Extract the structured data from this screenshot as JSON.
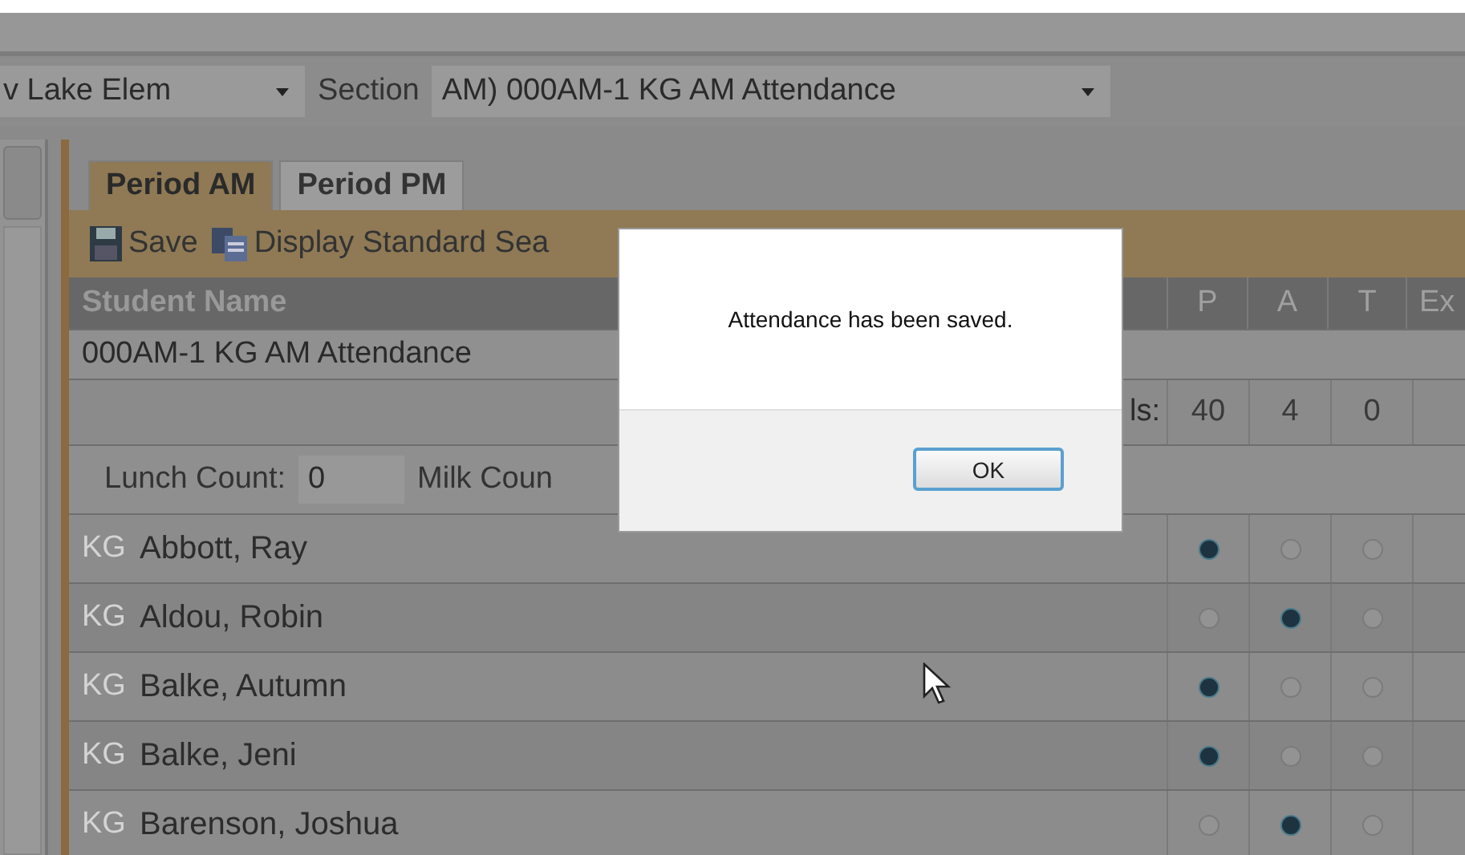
{
  "filters": {
    "school": "v Lake Elem",
    "section_label": "Section",
    "section": "AM) 000AM-1 KG AM Attendance"
  },
  "tabs": [
    {
      "label": "Period AM",
      "selected": true
    },
    {
      "label": "Period PM",
      "selected": false
    }
  ],
  "toolbar": {
    "save": "Save",
    "display": "Display Standard Sea"
  },
  "table": {
    "name_header": "Student Name",
    "columns": [
      "P",
      "A",
      "T",
      "Ex"
    ],
    "section_row": "000AM-1 KG AM Attendance",
    "totals_label": "ls:",
    "totals": [
      "40",
      "4",
      "0"
    ],
    "lunch_label": "Lunch Count:",
    "lunch_value": "0",
    "milk_label": "Milk Coun",
    "rows": [
      {
        "grade": "KG",
        "name": "Abbott, Ray",
        "marks": [
          {
            "selected": true
          },
          {
            "selected": false
          },
          {
            "selected": false
          }
        ]
      },
      {
        "grade": "KG",
        "name": "Aldou, Robin",
        "marks": [
          {
            "selected": false
          },
          {
            "selected": true
          },
          {
            "selected": false
          }
        ]
      },
      {
        "grade": "KG",
        "name": "Balke, Autumn",
        "marks": [
          {
            "selected": true
          },
          {
            "selected": false
          },
          {
            "selected": false
          }
        ]
      },
      {
        "grade": "KG",
        "name": "Balke, Jeni",
        "marks": [
          {
            "selected": true
          },
          {
            "selected": false
          },
          {
            "selected": false
          }
        ]
      },
      {
        "grade": "KG",
        "name": "Barenson, Joshua",
        "marks": [
          {
            "selected": false
          },
          {
            "selected": true
          },
          {
            "selected": false
          }
        ]
      }
    ]
  },
  "dialog": {
    "message": "Attendance has been saved.",
    "button": "OK"
  }
}
